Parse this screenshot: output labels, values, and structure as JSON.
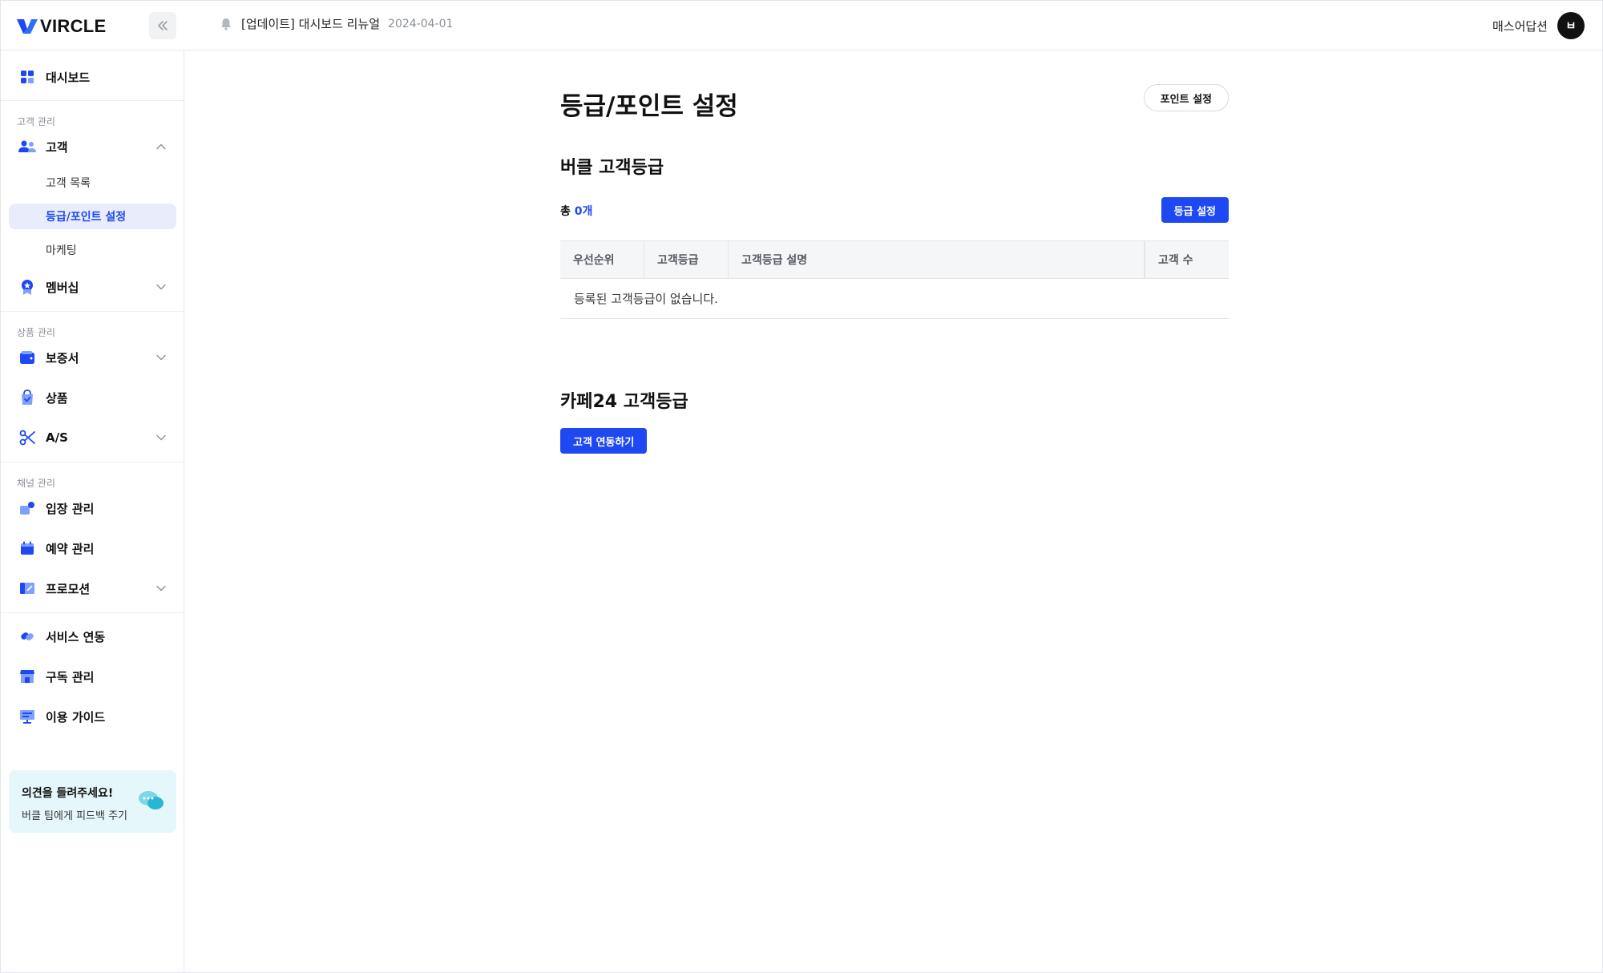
{
  "app": {
    "logo_text": "VIRCLE",
    "brand_color": "#1e48f2"
  },
  "header": {
    "notice_title": "[업데이트] 대시보드 리뉴얼",
    "notice_date": "2024-04-01",
    "account_name": "매스어답션",
    "avatar_initial": "ㅂ"
  },
  "sidebar": {
    "dashboard": "대시보드",
    "customer_section": "고객 관리",
    "customer": "고객",
    "customer_list": "고객 목록",
    "grade_point": "등급/포인트 설정",
    "marketing": "마케팅",
    "membership": "멤버십",
    "product_section": "상품 관리",
    "warranty": "보증서",
    "product": "상품",
    "as": "A/S",
    "channel_section": "채널 관리",
    "entry": "입장 관리",
    "reservation": "예약 관리",
    "promotion": "프로모션",
    "service_link": "서비스 연동",
    "subscription": "구독 관리",
    "guide": "이용 가이드",
    "feedback_title": "의견을 들려주세요!",
    "feedback_sub": "버클 팀에게 피드백 주기"
  },
  "main": {
    "page_title": "등급/포인트 설정",
    "point_button": "포인트 설정",
    "vircle_section_title": "버클 고객등급",
    "total_prefix": "총",
    "total_count": "0개",
    "grade_button": "등급 설정",
    "table": {
      "columns": [
        "우선순위",
        "고객등급",
        "고객등급 설명",
        "고객 수"
      ],
      "empty_message": "등록된 고객등급이 없습니다."
    },
    "cafe24_section_title": "카페24 고객등급",
    "connect_button": "고객 연동하기"
  }
}
